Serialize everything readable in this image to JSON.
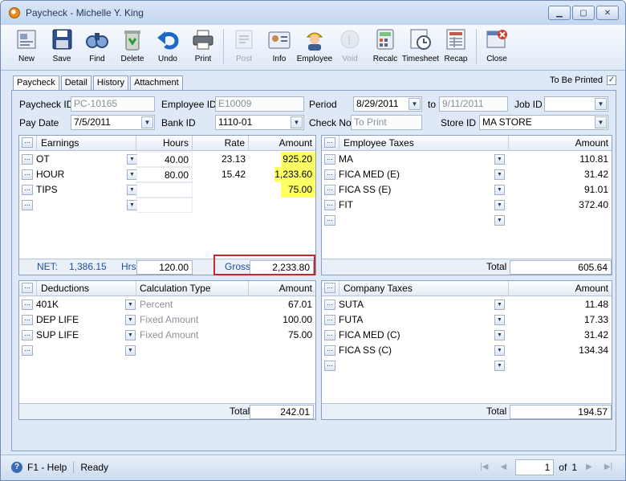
{
  "window": {
    "title": "Paycheck - Michelle Y. King"
  },
  "toolbar": [
    {
      "label": "New",
      "icon": "new-icon",
      "enabled": true
    },
    {
      "label": "Save",
      "icon": "save-icon",
      "enabled": true
    },
    {
      "label": "Find",
      "icon": "find-icon",
      "enabled": true
    },
    {
      "label": "Delete",
      "icon": "delete-icon",
      "enabled": true
    },
    {
      "label": "Undo",
      "icon": "undo-icon",
      "enabled": true
    },
    {
      "label": "Print",
      "icon": "print-icon",
      "enabled": true
    },
    {
      "label": "Post",
      "icon": "post-icon",
      "enabled": false
    },
    {
      "label": "Info",
      "icon": "info-icon",
      "enabled": true
    },
    {
      "label": "Employee",
      "icon": "employee-icon",
      "enabled": true
    },
    {
      "label": "Void",
      "icon": "void-icon",
      "enabled": false
    },
    {
      "label": "Recalc",
      "icon": "recalc-icon",
      "enabled": true
    },
    {
      "label": "Timesheet",
      "icon": "timesheet-icon",
      "enabled": true
    },
    {
      "label": "Recap",
      "icon": "recap-icon",
      "enabled": true
    },
    {
      "label": "Close",
      "icon": "close-icon",
      "enabled": true
    }
  ],
  "tabs": [
    "Paycheck",
    "Detail",
    "History",
    "Attachment"
  ],
  "to_be_printed": {
    "label": "To Be Printed",
    "checked": "✓"
  },
  "form": {
    "paycheck_id_label": "Paycheck ID",
    "paycheck_id": "PC-10165",
    "employee_id_label": "Employee ID",
    "employee_id": "E10009",
    "period_label": "Period",
    "period_from": "8/29/2011",
    "to_label": "to",
    "period_to": "9/11/2011",
    "job_id_label": "Job ID",
    "job_id": "",
    "pay_date_label": "Pay Date",
    "pay_date": "7/5/2011",
    "bank_id_label": "Bank ID",
    "bank_id": "1110-01",
    "check_no_label": "Check No",
    "check_no_placeholder": "To Print",
    "store_id_label": "Store ID",
    "store_id": "MA STORE"
  },
  "earnings": {
    "headers": {
      "name": "Earnings",
      "hours": "Hours",
      "rate": "Rate",
      "amount": "Amount"
    },
    "rows": [
      {
        "name": "OT",
        "hours": "40.00",
        "rate": "23.13",
        "amount": "925.20"
      },
      {
        "name": "HOUR",
        "hours": "80.00",
        "rate": "15.42",
        "amount": "1,233.60"
      },
      {
        "name": "TIPS",
        "hours": "",
        "rate": "",
        "amount": "75.00"
      },
      {
        "name": "",
        "hours": "",
        "rate": "",
        "amount": ""
      }
    ],
    "footer": {
      "net_label": "NET:",
      "net": "1,386.15",
      "hrs_label": "Hrs",
      "hrs": "120.00",
      "gross_label": "Gross",
      "gross": "2,233.80"
    }
  },
  "employee_taxes": {
    "headers": {
      "name": "Employee Taxes",
      "amount": "Amount"
    },
    "rows": [
      {
        "name": "MA",
        "amount": "110.81"
      },
      {
        "name": "FICA MED (E)",
        "amount": "31.42"
      },
      {
        "name": "FICA SS (E)",
        "amount": "91.01"
      },
      {
        "name": "FIT",
        "amount": "372.40"
      },
      {
        "name": "",
        "amount": ""
      }
    ],
    "footer": {
      "total_label": "Total",
      "total": "605.64"
    }
  },
  "deductions": {
    "headers": {
      "name": "Deductions",
      "calc": "Calculation Type",
      "amount": "Amount"
    },
    "rows": [
      {
        "name": "401K",
        "calc": "Percent",
        "amount": "67.01"
      },
      {
        "name": "DEP LIFE",
        "calc": "Fixed Amount",
        "amount": "100.00"
      },
      {
        "name": "SUP LIFE",
        "calc": "Fixed Amount",
        "amount": "75.00"
      },
      {
        "name": "",
        "calc": "",
        "amount": ""
      }
    ],
    "footer": {
      "total_label": "Total",
      "total": "242.01"
    }
  },
  "company_taxes": {
    "headers": {
      "name": "Company Taxes",
      "amount": "Amount"
    },
    "rows": [
      {
        "name": "SUTA",
        "amount": "11.48"
      },
      {
        "name": "FUTA",
        "amount": "17.33"
      },
      {
        "name": "FICA MED (C)",
        "amount": "31.42"
      },
      {
        "name": "FICA SS (C)",
        "amount": "134.34"
      },
      {
        "name": "",
        "amount": ""
      }
    ],
    "footer": {
      "total_label": "Total",
      "total": "194.57"
    }
  },
  "status": {
    "help": "F1 - Help",
    "state": "Ready",
    "page": "1",
    "of_label": "of",
    "total_pages": "1"
  },
  "colors": {
    "highlight": "#ffff66",
    "header_blue": "#1e4e9c",
    "callout": "#c22b2b"
  }
}
